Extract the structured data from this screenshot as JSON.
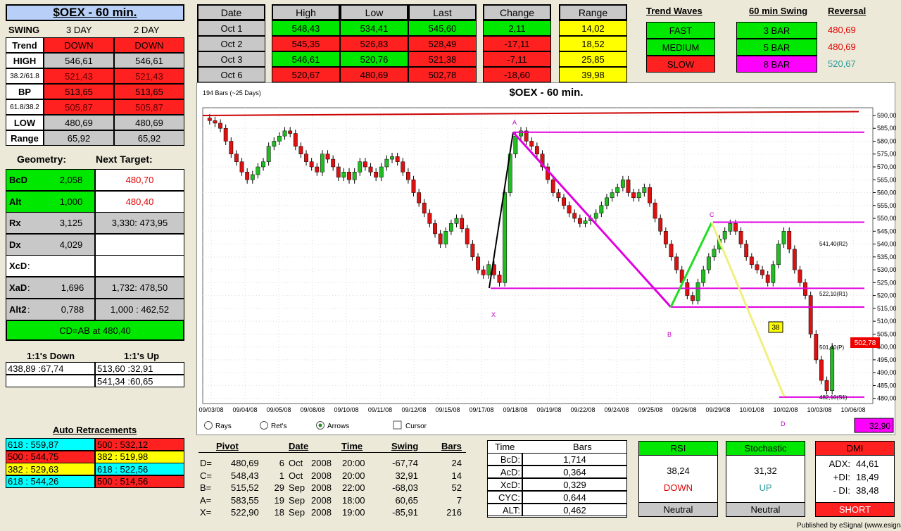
{
  "title": "$OEX - 60 min.",
  "swing": {
    "h": "SWING",
    "c1": "3 DAY",
    "c2": "2 DAY",
    "rows": [
      {
        "label": "Trend",
        "v1": "DOWN",
        "v2": "DOWN"
      },
      {
        "label": "HIGH",
        "v1": "546,61",
        "v2": "546,61"
      },
      {
        "label": "38.2/61.8",
        "v1": "521,43",
        "v2": "521,43"
      },
      {
        "label": "BP",
        "v1": "513,65",
        "v2": "513,65"
      },
      {
        "label": "61.8/38.2",
        "v1": "505,87",
        "v2": "505,87"
      },
      {
        "label": "LOW",
        "v1": "480,69",
        "v2": "480,69"
      },
      {
        "label": "Range",
        "v1": "65,92",
        "v2": "65,92"
      }
    ]
  },
  "geometry": {
    "title": "Geometry:",
    "next": "Next Target:",
    "rows": [
      {
        "label": "BcD",
        "v": "2,058",
        "t": "480,70"
      },
      {
        "label": "Alt",
        "v": "1,000",
        "t": "480,40"
      },
      {
        "label": "Rx",
        "v": "3,125",
        "t": "3,330: 473,95"
      },
      {
        "label": "Dx",
        "v": "4,029",
        "t": ""
      },
      {
        "label": "XcD",
        "v": "",
        "t": ""
      },
      {
        "label": "XaD",
        "v": "1,696",
        "t": "1,732: 478,50"
      },
      {
        "label": "Alt2",
        "v": "0,788",
        "t": "1,000 : 462,52"
      }
    ],
    "cd": "CD=AB at 480,40"
  },
  "ones": {
    "down_h": "1:1's Down",
    "up_h": "1:1's Up",
    "down": [
      "438,89 :67,74",
      ""
    ],
    "up": [
      "513,60 :32,91",
      "541,34 :60,65"
    ]
  },
  "auto": {
    "title": "Auto Retracements",
    "rows": [
      [
        "618 : 559,87",
        "500 : 532,12"
      ],
      [
        "500 : 544,75",
        "382 : 519,98"
      ],
      [
        "382 : 529,63",
        "618 : 522,56"
      ],
      [
        "618 : 544,26",
        "500 : 514,56"
      ]
    ]
  },
  "ohlc": {
    "h": [
      "Date",
      "High",
      "Low",
      "Last",
      "Change",
      "Range"
    ],
    "rows": [
      {
        "date": "Oct  1",
        "high": "548,43",
        "low": "534,41",
        "last": "545,60",
        "chg": "2,11",
        "rng": "14,02"
      },
      {
        "date": "Oct  2",
        "high": "545,35",
        "low": "526,83",
        "last": "528,49",
        "chg": "-17,11",
        "rng": "18,52"
      },
      {
        "date": "Oct  3",
        "high": "546,61",
        "low": "520,76",
        "last": "521,38",
        "chg": "-7,11",
        "rng": "25,85"
      },
      {
        "date": "Oct  6",
        "high": "520,67",
        "low": "480,69",
        "last": "502,78",
        "chg": "-18,60",
        "rng": "39,98"
      }
    ]
  },
  "trend": {
    "h": "Trend Waves",
    "items": [
      "FAST",
      "MEDIUM",
      "SLOW"
    ]
  },
  "swing60": {
    "h": "60 min Swing",
    "items": [
      "3 BAR",
      "5 BAR",
      "8 BAR"
    ]
  },
  "reversal": {
    "h": "Reversal",
    "items": [
      "480,69",
      "480,69",
      "520,67"
    ]
  },
  "chart": {
    "title": "$OEX - 60 min.",
    "bars": "194 Bars (~25 Days)",
    "last": "502,78",
    "box": "32,90",
    "tag38": "38",
    "radio": [
      "Rays",
      "Ret's",
      "Arrows",
      "Cursor"
    ],
    "levels": [
      "541,40(R2)",
      "522,10(R1)",
      "501,40(P)",
      "482,10(S1)"
    ],
    "points": [
      "A",
      "X",
      "C",
      "B",
      "D"
    ]
  },
  "chart_data": {
    "type": "candlestick",
    "title": "$OEX - 60 min.",
    "y_ticks": [
      480,
      485,
      490,
      495,
      500,
      505,
      510,
      515,
      520,
      525,
      530,
      535,
      540,
      545,
      550,
      555,
      560,
      565,
      570,
      575,
      580,
      585,
      590
    ],
    "y_labels": [
      "480,00",
      "485,00",
      "490,00",
      "495,00",
      "500,00",
      "505,00",
      "510,00",
      "515,00",
      "520,00",
      "525,00",
      "530,00",
      "535,00",
      "540,00",
      "545,00",
      "550,00",
      "555,00",
      "560,00",
      "565,00",
      "570,00",
      "575,00",
      "580,00",
      "585,00",
      "590,00"
    ],
    "x_labels": [
      "09/03/08",
      "09/04/08",
      "09/05/08",
      "09/08/08",
      "09/10/08",
      "09/11/08",
      "09/12/08",
      "09/15/08",
      "09/17/08",
      "09/18/08",
      "09/19/08",
      "09/22/08",
      "09/24/08",
      "09/25/08",
      "09/26/08",
      "09/29/08",
      "10/01/08",
      "10/02/08",
      "10/03/08",
      "10/06/08"
    ],
    "ylim": [
      478,
      593
    ],
    "close": [
      588,
      587,
      585,
      580,
      575,
      572,
      568,
      565,
      567,
      570,
      572,
      578,
      580,
      582,
      584,
      583,
      578,
      575,
      572,
      570,
      568,
      575,
      573,
      570,
      566,
      568,
      565,
      568,
      572,
      570,
      568,
      566,
      570,
      573,
      574,
      572,
      568,
      565,
      560,
      556,
      552,
      548,
      544,
      540,
      545,
      548,
      550,
      546,
      540,
      535,
      530,
      528,
      532,
      528,
      525,
      560,
      575,
      582,
      584,
      580,
      578,
      575,
      570,
      565,
      560,
      558,
      555,
      552,
      550,
      548,
      549,
      550,
      552,
      555,
      558,
      560,
      562,
      565,
      560,
      558,
      560,
      562,
      556,
      550,
      545,
      540,
      535,
      530,
      525,
      520,
      518,
      525,
      530,
      535,
      538,
      542,
      545,
      548,
      545,
      540,
      535,
      532,
      530,
      528,
      525,
      532,
      540,
      545,
      538,
      530,
      525,
      520,
      505,
      495,
      487,
      483,
      500
    ]
  },
  "pivot": {
    "h": [
      "Pivot",
      "Date",
      "Time",
      "Swing",
      "Bars"
    ],
    "rows": [
      {
        "l": "D=",
        "p": "480,69",
        "d": "6",
        "m": "Oct",
        "y": "2008",
        "t": "20:00",
        "s": "-67,74",
        "b": "24"
      },
      {
        "l": "C=",
        "p": "548,43",
        "d": "1",
        "m": "Oct",
        "y": "2008",
        "t": "20:00",
        "s": "32,91",
        "b": "14"
      },
      {
        "l": "B=",
        "p": "515,52",
        "d": "29",
        "m": "Sep",
        "y": "2008",
        "t": "22:00",
        "s": "-68,03",
        "b": "52"
      },
      {
        "l": "A=",
        "p": "583,55",
        "d": "19",
        "m": "Sep",
        "y": "2008",
        "t": "18:00",
        "s": "60,65",
        "b": "7"
      },
      {
        "l": "X=",
        "p": "522,90",
        "d": "18",
        "m": "Sep",
        "y": "2008",
        "t": "19:00",
        "s": "-85,91",
        "b": "216"
      }
    ]
  },
  "timebars": {
    "h1": "Time",
    "h2": "Bars",
    "rows": [
      {
        "l": "BcD:",
        "v": "1,714"
      },
      {
        "l": "AcD:",
        "v": "0,364"
      },
      {
        "l": "XcD:",
        "v": "0,329"
      },
      {
        "l": "CYC:",
        "v": "0,644"
      },
      {
        "l": "ALT:",
        "v": "0,462"
      }
    ]
  },
  "rsi": {
    "h": "RSI",
    "v": "38,24",
    "s": "DOWN",
    "f": "Neutral"
  },
  "stoch": {
    "h": "Stochastic",
    "v": "31,32",
    "s": "UP",
    "f": "Neutral"
  },
  "dmi": {
    "h": "DMI",
    "adx_l": "ADX:",
    "adx": "44,61",
    "pdi_l": "+DI:",
    "pdi": "18,49",
    "mdi_l": "- DI:",
    "mdi": "38,48",
    "f": "SHORT"
  },
  "footer": "Published by eSignal (www.esignal.com)"
}
